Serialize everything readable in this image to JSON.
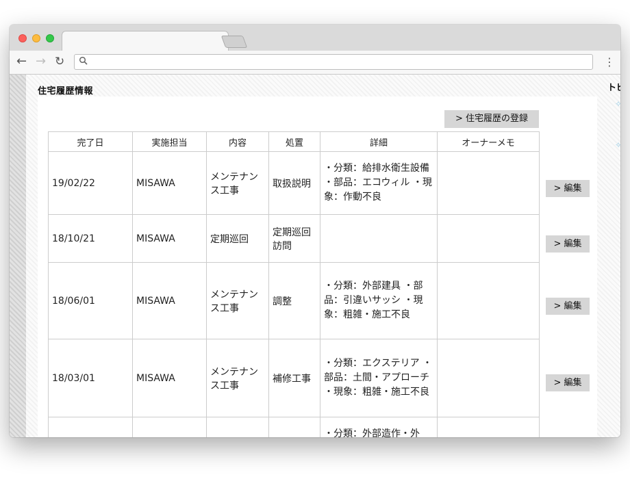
{
  "section_title": "住宅履歴情報",
  "right_title": "トピ",
  "register_button": "> 住宅履歴の登録",
  "columns": [
    "完了日",
    "実施担当",
    "内容",
    "処置",
    "詳細",
    "オーナーメモ"
  ],
  "edit_label": "> 編集",
  "rows": [
    {
      "date": "19/02/22",
      "staff": "MISAWA",
      "content": "メンテナンス工事",
      "action": "取扱説明",
      "detail": "・分類：給排水衛生設備 ・部品：エコウィル ・現象：作動不良",
      "memo": ""
    },
    {
      "date": "18/10/21",
      "staff": "MISAWA",
      "content": "定期巡回",
      "action": "定期巡回訪問",
      "detail": "",
      "memo": ""
    },
    {
      "date": "18/06/01",
      "staff": "MISAWA",
      "content": "メンテナンス工事",
      "action": "調整",
      "detail": "・分類：外部建具 ・部品：引違いサッシ ・現象：粗雑・施工不良",
      "memo": ""
    },
    {
      "date": "18/03/01",
      "staff": "MISAWA",
      "content": "メンテナンス工事",
      "action": "補修工事",
      "detail": "・分類：エクステリア ・部品：土間・アプローチ ・現象：粗雑・施工不良",
      "memo": ""
    },
    {
      "date": "",
      "staff": "",
      "content": "",
      "action": "",
      "detail": "・分類：外部造作・外",
      "memo": ""
    }
  ]
}
